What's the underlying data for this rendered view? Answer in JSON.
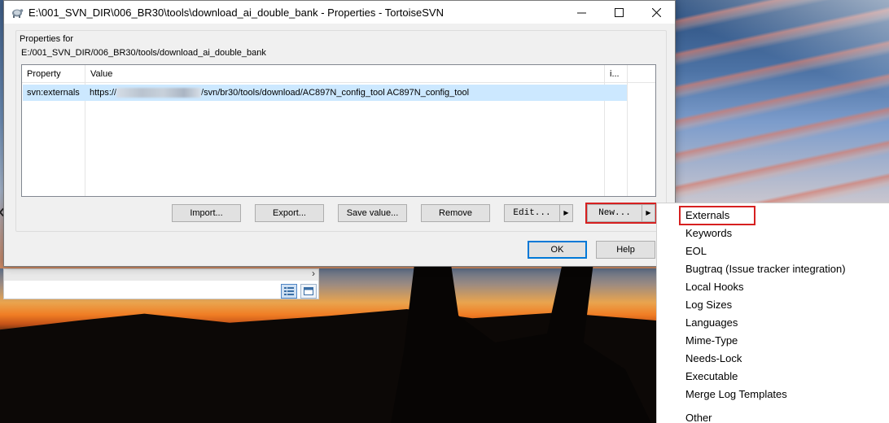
{
  "window": {
    "title": "E:\\001_SVN_DIR\\006_BR30\\tools\\download_ai_double_bank - Properties - TortoiseSVN",
    "controls": {
      "minimize": "—",
      "maximize": "☐",
      "close": "✕"
    }
  },
  "properties": {
    "group_label": "Properties for",
    "path": "E:/001_SVN_DIR/006_BR30/tools/download_ai_double_bank",
    "columns": [
      "Property",
      "Value",
      "i..."
    ],
    "rows": [
      {
        "property": "svn:externals",
        "value_prefix": "https://",
        "value_suffix": "/svn/br30/tools/download/AC897N_config_tool AC897N_config_tool"
      }
    ]
  },
  "buttons": {
    "import": "Import...",
    "export": "Export...",
    "save_value": "Save value...",
    "remove": "Remove",
    "edit": "Edit...",
    "new": "New...",
    "ok": "OK",
    "help": "Help"
  },
  "context_menu": {
    "items": [
      "Externals",
      "Keywords",
      "EOL",
      "Bugtraq (Issue tracker integration)",
      "Local Hooks",
      "Log Sizes",
      "Languages",
      "Mime-Type",
      "Needs-Lock",
      "Executable",
      "Merge Log Templates",
      "Other"
    ],
    "selected": "Externals"
  },
  "colors": {
    "highlight_outline": "#d62020",
    "selection_row": "#cce8ff",
    "default_button_border": "#0078d7"
  },
  "icons": {
    "app": "tortoisesvn-icon",
    "split_arrow": "triangle-right-icon",
    "left_nav": "chevron-left-icon",
    "scroll_right": "chevron-right-icon"
  }
}
